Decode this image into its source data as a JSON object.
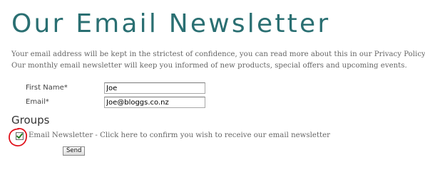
{
  "page": {
    "title": "Our Email Newsletter",
    "intro_line_1": "Your email address will be kept in the strictest of confidence, you can read more about this in our Privacy Policy.",
    "intro_line_2": "Our monthly email newsletter will keep you informed of new products, special offers and upcoming events."
  },
  "form": {
    "first_name": {
      "label": "First Name*",
      "value": "Joe"
    },
    "email": {
      "label": "Email*",
      "value": "Joe@bloggs.co.nz"
    }
  },
  "groups": {
    "heading": "Groups",
    "newsletter_checkbox": {
      "checked": true,
      "label": "Email Newsletter - Click here to confirm you wish to receive our email newsletter"
    }
  },
  "send_button": {
    "label": "Send"
  },
  "colors": {
    "title": "#2a6f72",
    "body_text": "#666666",
    "annotation_circle": "#e0101a",
    "check_mark": "#1a7a1a"
  },
  "icons": {
    "check": "check-icon",
    "annotation": "highlight-circle"
  }
}
